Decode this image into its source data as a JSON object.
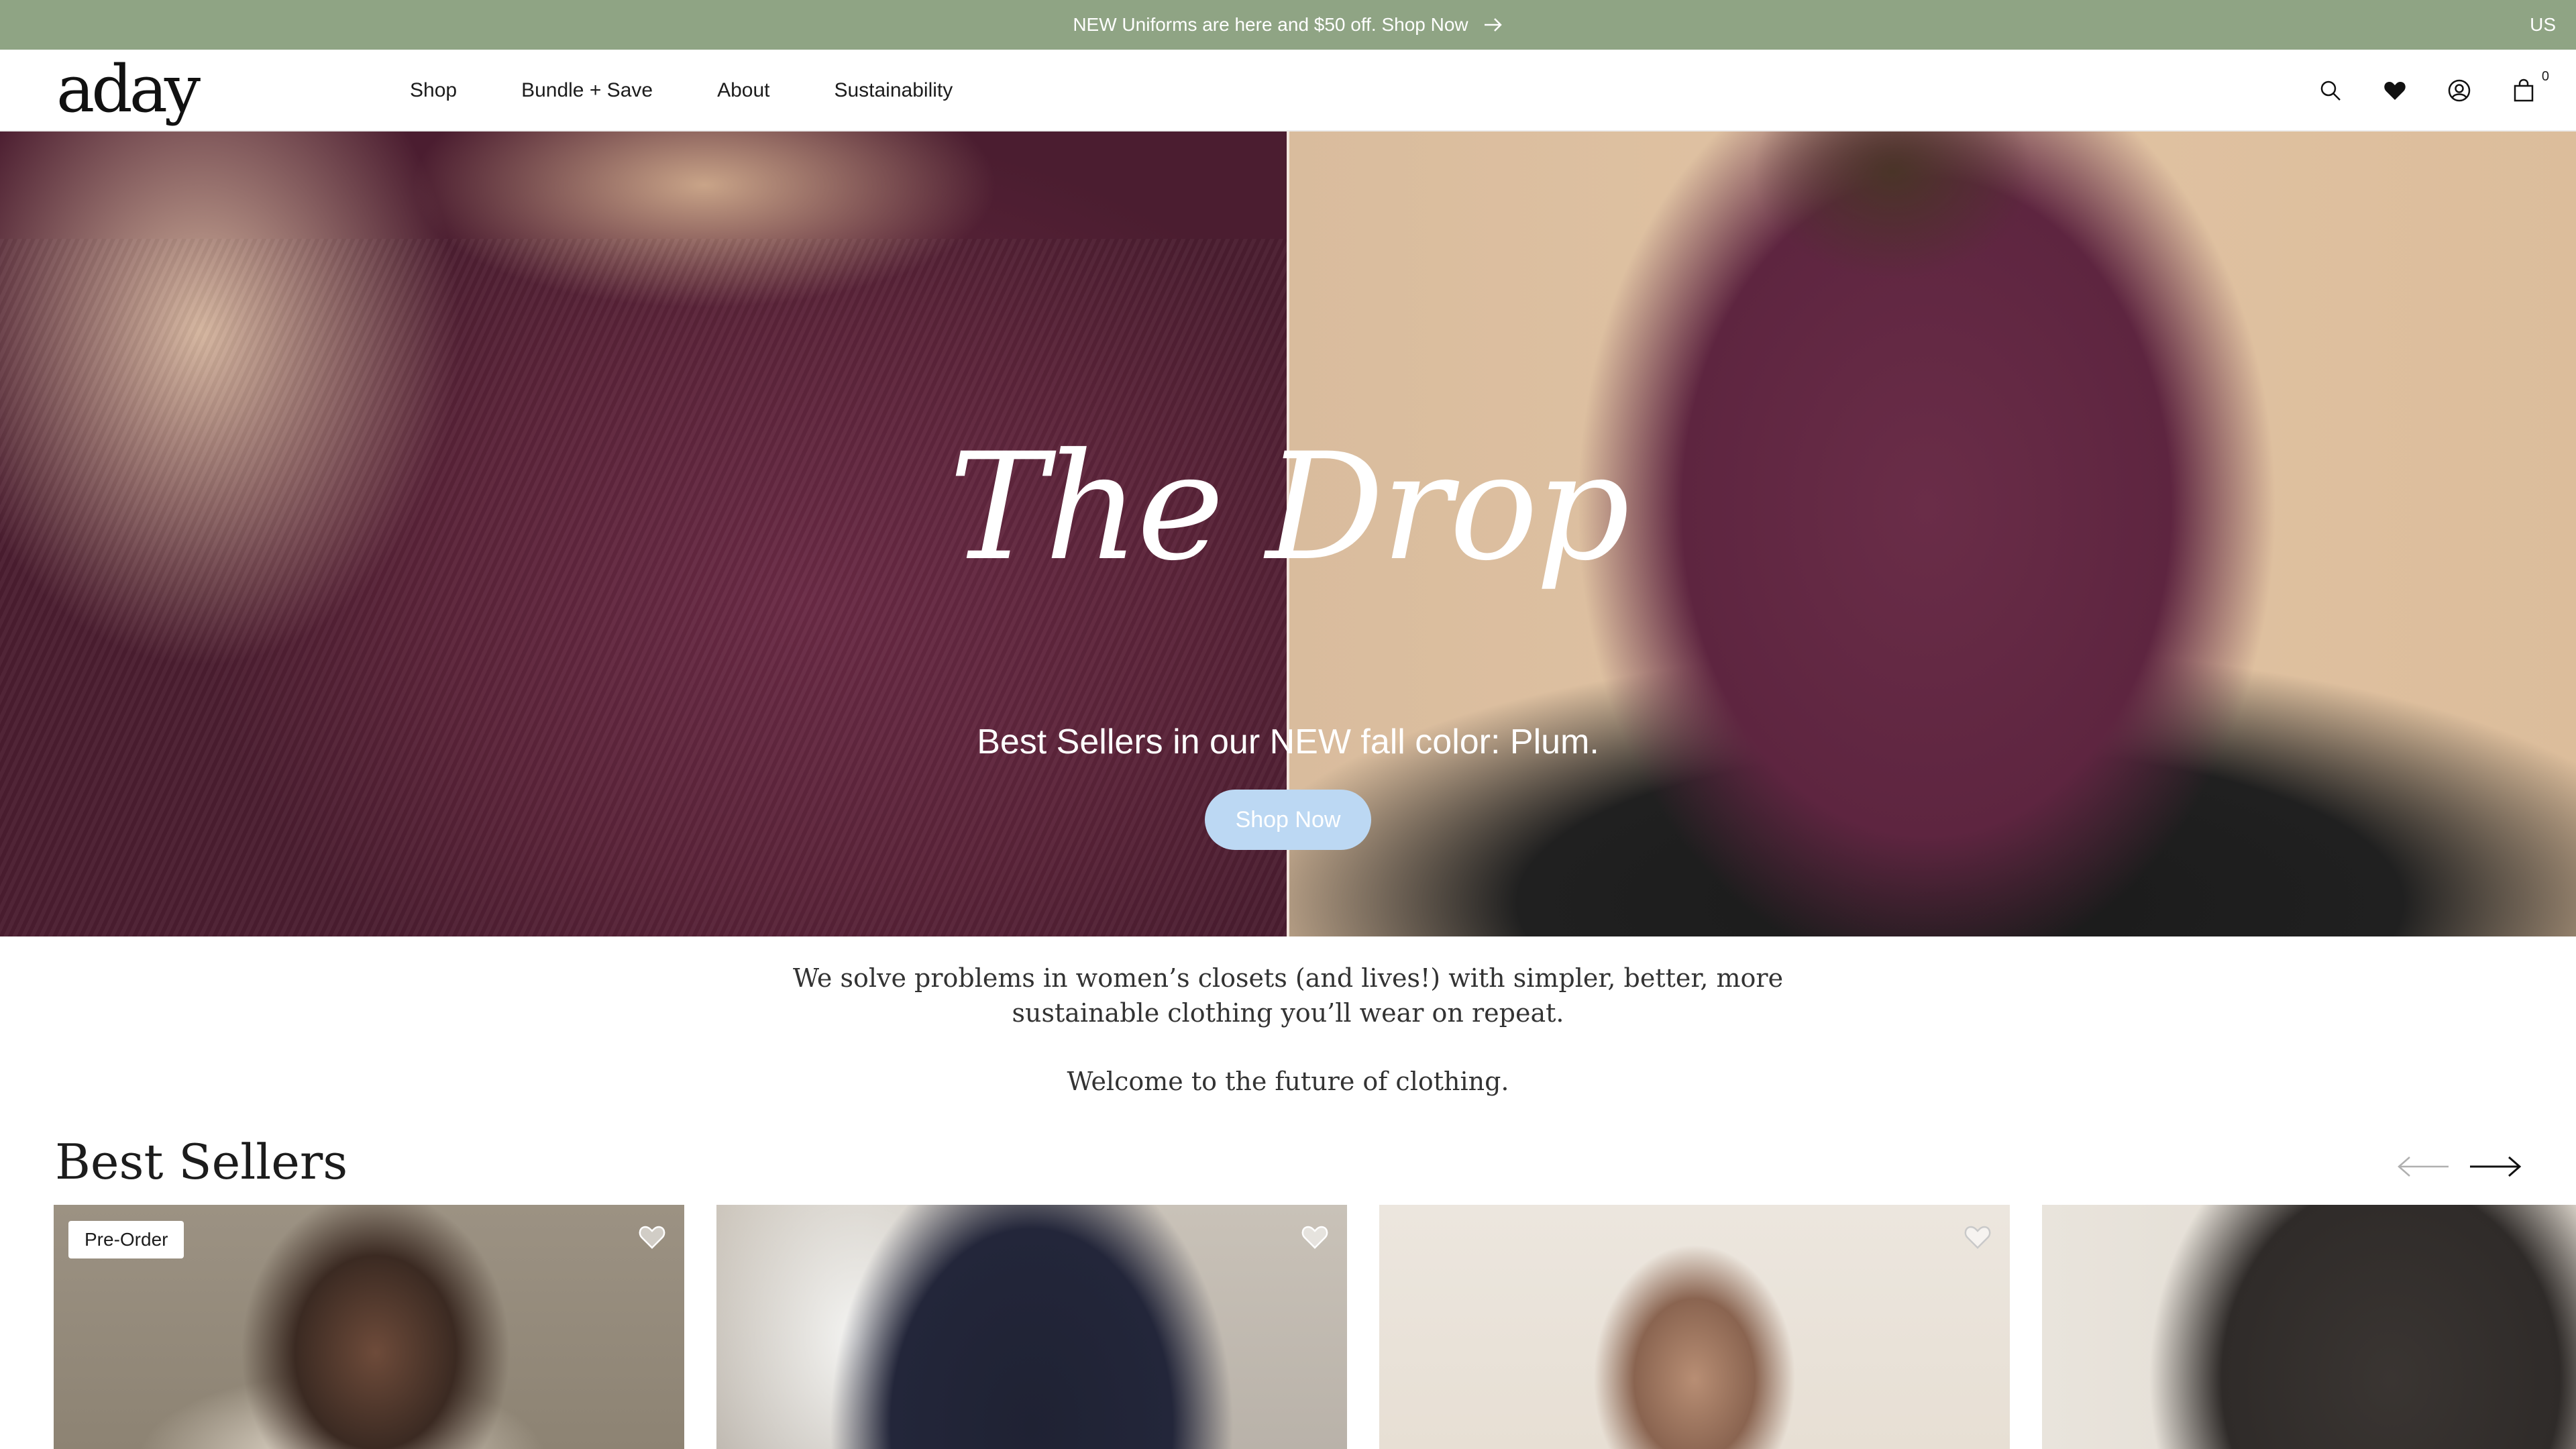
{
  "announcement": {
    "text": "NEW Uniforms are here and $50 off. Shop Now",
    "arrow_icon": "arrow-right-icon",
    "region": "US"
  },
  "header": {
    "logo": "aday",
    "nav": [
      "Shop",
      "Bundle + Save",
      "About",
      "Sustainability"
    ],
    "icons": [
      "search-icon",
      "heart-icon",
      "account-icon",
      "bag-icon"
    ],
    "cart_count": "0"
  },
  "hero": {
    "title": "The Drop",
    "subtitle": "Best Sellers in our NEW fall color: Plum.",
    "cta": "Shop Now",
    "cta_color": "#bcd8f3"
  },
  "mission": {
    "text": "We solve problems in women’s closets (and lives!) with simpler, better, more sustainable clothing you’ll wear on repeat.",
    "welcome": "Welcome to the future of clothing."
  },
  "best_sellers": {
    "title": "Best Sellers",
    "prev_icon": "arrow-left-icon",
    "next_icon": "arrow-right-icon",
    "badge": "Pre-Order",
    "favorite_icon": "heart-outline-icon"
  },
  "colors": {
    "announcement_bg": "#8fa484",
    "plum": "#5b2339"
  }
}
